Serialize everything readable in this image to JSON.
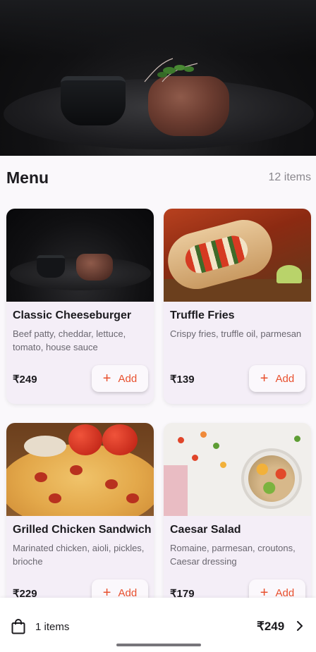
{
  "menu": {
    "title": "Menu",
    "count": "12 items"
  },
  "items": [
    {
      "name": "Classic Cheeseburger",
      "description": "Beef patty, cheddar, lettuce, tomato, house sauce",
      "price": "₹249",
      "add_label": "Add",
      "image": "steak-photo"
    },
    {
      "name": "Truffle Fries",
      "description": "Crispy fries, truffle oil, parmesan",
      "price": "₹139",
      "add_label": "Add",
      "image": "wrap-photo"
    },
    {
      "name": "Grilled Chicken Sandwich",
      "description": "Marinated chicken, aioli, pickles, brioche",
      "price": "₹229",
      "add_label": "Add",
      "image": "pizza-photo"
    },
    {
      "name": "Caesar Salad",
      "description": "Romaine, parmesan, croutons, Caesar dressing",
      "price": "₹179",
      "add_label": "Add",
      "image": "salad-photo"
    }
  ],
  "cart": {
    "count_label": "1 items",
    "total": "₹249",
    "icon": "shopping-bag-icon",
    "chevron": "chevron-right-icon"
  },
  "colors": {
    "accent": "#e8502e",
    "card_bg": "#f4eef7",
    "page_bg": "#faf8fb"
  }
}
